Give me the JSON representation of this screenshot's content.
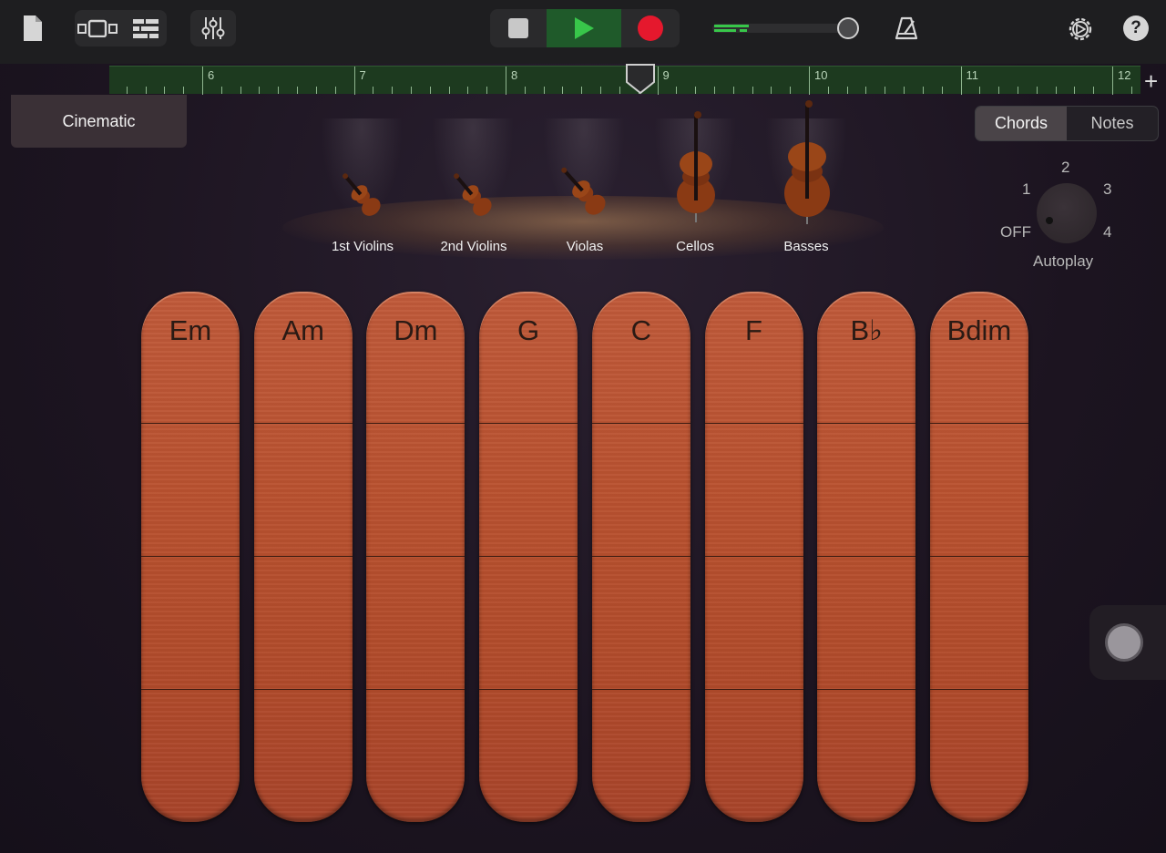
{
  "toolbar": {
    "icons": [
      "document-icon",
      "browser-view-icon",
      "tracks-view-icon",
      "mixer-icon",
      "stop-icon",
      "play-icon",
      "record-icon",
      "metronome-icon",
      "settings-icon",
      "help-icon"
    ],
    "colors": {
      "play_bg": "#1f5a2a",
      "record": "#e5182d",
      "level": "#38c74a"
    }
  },
  "ruler": {
    "bars": [
      "6",
      "7",
      "8",
      "9",
      "10",
      "11",
      "12"
    ],
    "add_label": "+"
  },
  "preset": {
    "label": "Cinematic"
  },
  "mode_switch": {
    "options": [
      "Chords",
      "Notes"
    ],
    "selected": "Chords"
  },
  "autoplay": {
    "label": "Autoplay",
    "positions": [
      "OFF",
      "1",
      "2",
      "3",
      "4"
    ],
    "selected": "OFF"
  },
  "instruments": [
    {
      "label": "1st Violins"
    },
    {
      "label": "2nd Violins"
    },
    {
      "label": "Violas"
    },
    {
      "label": "Cellos"
    },
    {
      "label": "Basses"
    }
  ],
  "chords": [
    "Em",
    "Am",
    "Dm",
    "G",
    "C",
    "F",
    "B♭",
    "Bdim"
  ],
  "strip_color": "#b9512f"
}
